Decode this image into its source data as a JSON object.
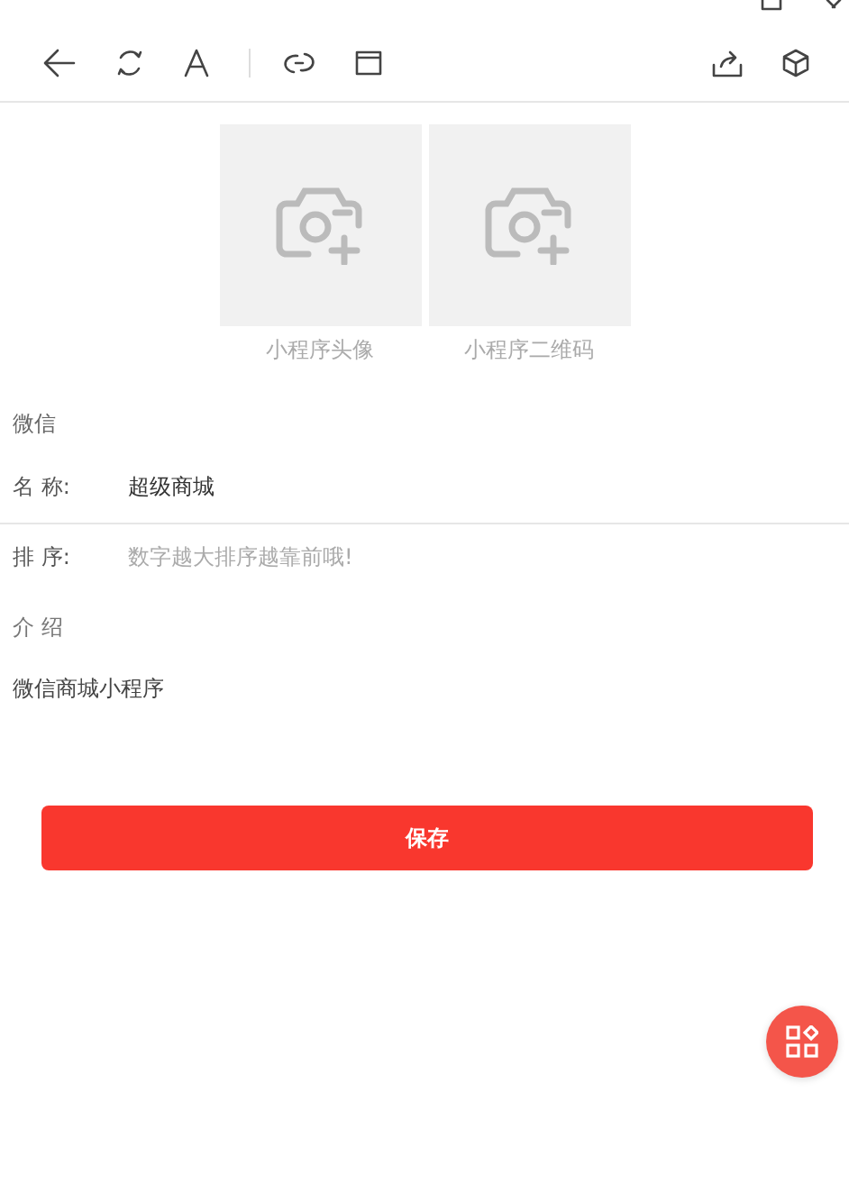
{
  "uploads": [
    {
      "label": "小程序头像"
    },
    {
      "label": "小程序二维码"
    }
  ],
  "section_title": "微信",
  "fields": [
    {
      "kind": "text",
      "label": "名 称:",
      "value": "超级商城"
    },
    {
      "kind": "input",
      "label": "排 序:",
      "placeholder": "数字越大排序越靠前哦!"
    }
  ],
  "intro": {
    "label": "介 绍",
    "value": "微信商城小程序"
  },
  "save_button": {
    "label": "保存"
  }
}
